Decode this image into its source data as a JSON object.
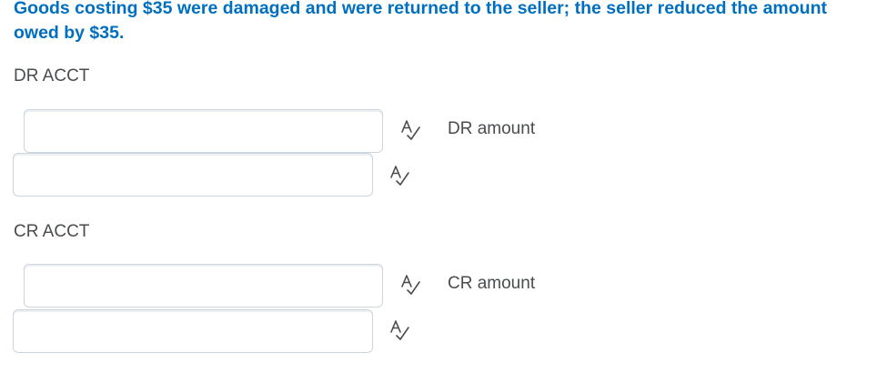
{
  "question": {
    "text": "Goods costing $35 were damaged and were returned to the seller; the seller reduced the amount owed by $35."
  },
  "debit": {
    "acct_label": "DR ACCT",
    "amount_label": "DR amount",
    "account_field": {
      "value": "",
      "placeholder": ""
    },
    "amount_field": {
      "value": "",
      "placeholder": ""
    }
  },
  "credit": {
    "acct_label": "CR ACCT",
    "amount_label": "CR amount",
    "account_field": {
      "value": "",
      "placeholder": ""
    },
    "amount_field": {
      "value": "",
      "placeholder": ""
    }
  },
  "icons": {
    "spell_check": "spell-check-icon"
  },
  "colors": {
    "question_text": "#006fbf",
    "body_text": "#494c4e",
    "field_border": "#cdd5dc"
  }
}
